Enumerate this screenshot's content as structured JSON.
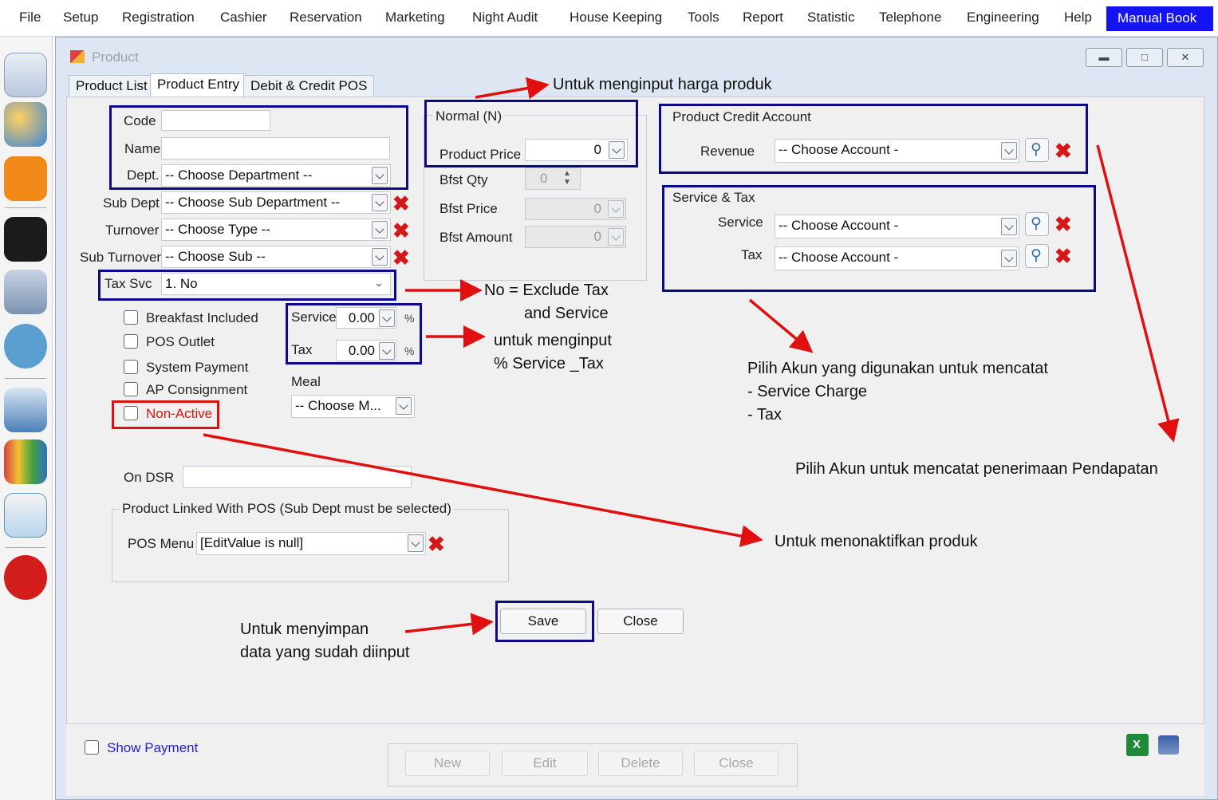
{
  "menu": [
    "File",
    "Setup",
    "Registration",
    "Cashier",
    "Reservation",
    "Marketing",
    "Night Audit",
    "House Keeping",
    "Tools",
    "Report",
    "Statistic",
    "Telephone",
    "Engineering",
    "Help"
  ],
  "manual_book": "Manual Book",
  "sidebar_icons": [
    "report-form-icon",
    "users-group-icon",
    "map-location-icon",
    "calendar-icon",
    "building-icon",
    "rooms-available-icon",
    "shopping-cart-icon",
    "bar-chart-icon",
    "pie-report-icon",
    "power-icon"
  ],
  "window": {
    "title": "Product",
    "buttons": [
      "minimize",
      "maximize",
      "close"
    ]
  },
  "tabs": [
    "Product List",
    "Product Entry",
    "Debit & Credit POS"
  ],
  "form": {
    "code_label": "Code",
    "code_value": "",
    "name_label": "Name",
    "name_value": "",
    "dept_label": "Dept.",
    "dept_value": "-- Choose Department --",
    "subdept_label": "Sub Dept",
    "subdept_value": "-- Choose Sub Department --",
    "turnover_label": "Turnover",
    "turnover_value": "-- Choose Type --",
    "subturnover_label": "Sub Turnover",
    "subturnover_value": "-- Choose Sub --",
    "taxsvc_label": "Tax Svc",
    "taxsvc_value": "1. No",
    "checks": [
      "Breakfast Included",
      "POS Outlet",
      "System Payment",
      "AP Consignment",
      "Non-Active"
    ],
    "service_label": "Service",
    "service_value": "0.00",
    "tax_label": "Tax",
    "tax_value": "0.00",
    "pct": "%",
    "meal_label": "Meal",
    "meal_value": "-- Choose M...",
    "ondsr_label": "On DSR",
    "ondsr_value": "",
    "pos_group_title": "Product Linked With POS (Sub Dept must be selected)",
    "pos_menu_label": "POS Menu",
    "pos_menu_value": "[EditValue is null]",
    "normal_title": "Normal (N)",
    "product_price_label": "Product Price",
    "product_price_value": "0",
    "bfst_qty_label": "Bfst Qty",
    "bfst_qty_value": "0",
    "bfst_price_label": "Bfst Price",
    "bfst_price_value": "0",
    "bfst_amount_label": "Bfst Amount",
    "bfst_amount_value": "0",
    "credit_title": "Product Credit Account",
    "revenue_label": "Revenue",
    "revenue_value": "-- Choose Account -",
    "svctax_title": "Service & Tax",
    "svc_acc_label": "Service",
    "svc_acc_value": "-- Choose Account -",
    "tax_acc_label": "Tax",
    "tax_acc_value": "-- Choose Account -",
    "save": "Save",
    "close": "Close"
  },
  "bottom": {
    "show_payment": "Show Payment",
    "new": "New",
    "edit": "Edit",
    "delete": "Delete",
    "close": "Close"
  },
  "notes": {
    "price": "Untuk menginput harga produk",
    "taxsvc_1": "No = Exclude Tax",
    "taxsvc_2": "and Service",
    "pct_1": "untuk menginput",
    "pct_2": "% Service _Tax",
    "acc_1": "Pilih Akun yang digunakan untuk mencatat",
    "acc_2": "- Service Charge",
    "acc_3": "- Tax",
    "revenue": "Pilih Akun untuk mencatat penerimaan Pendapatan",
    "nonactive": "Untuk menonaktifkan produk",
    "save_1": "Untuk menyimpan",
    "save_2": "data yang sudah diinput"
  },
  "colors": {
    "annotation_box": "#0a0a8a",
    "annotation_arrow": "#e01010",
    "manual_book_bg": "#1414f0"
  }
}
